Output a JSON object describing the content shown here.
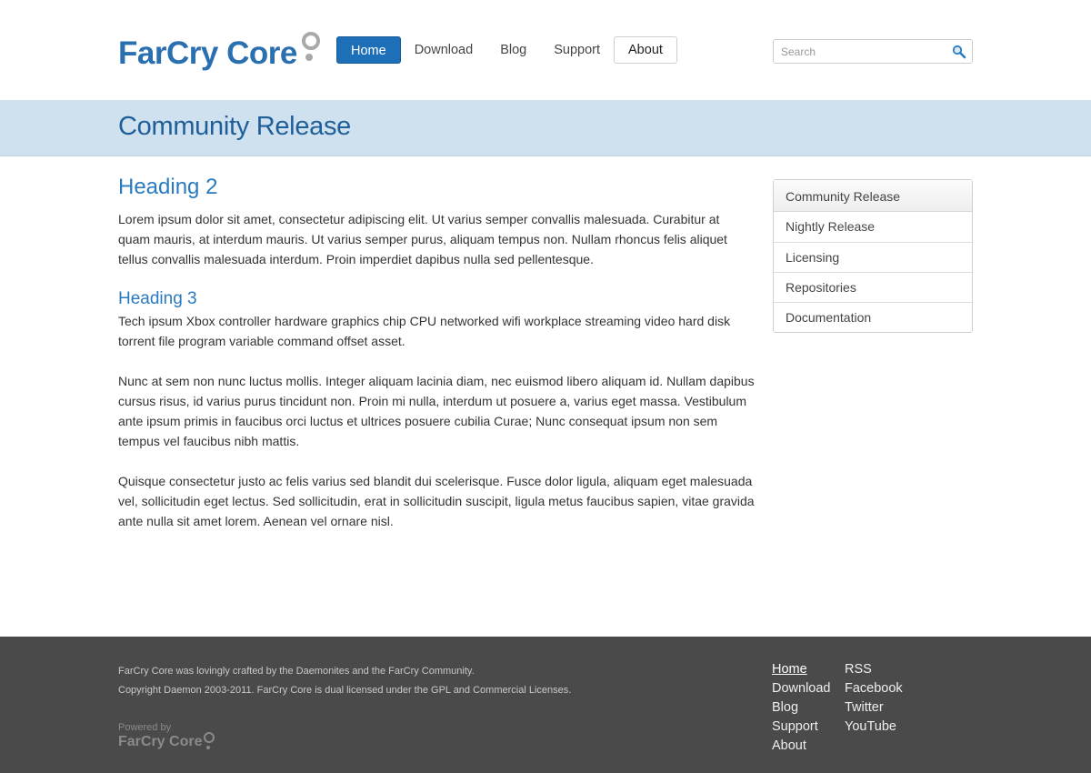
{
  "brand": {
    "logo_text_a": "FarCry",
    "logo_text_b": "Core"
  },
  "nav": {
    "items": [
      {
        "label": "Home",
        "state": "active"
      },
      {
        "label": "Download",
        "state": "normal"
      },
      {
        "label": "Blog",
        "state": "normal"
      },
      {
        "label": "Support",
        "state": "normal"
      },
      {
        "label": "About",
        "state": "outlined"
      }
    ]
  },
  "search": {
    "placeholder": "Search",
    "value": "",
    "icon": "magnifier-icon"
  },
  "banner": {
    "title": "Community Release"
  },
  "content": {
    "heading2": "Heading 2",
    "para1": "Lorem ipsum dolor sit amet, consectetur adipiscing elit. Ut varius semper convallis malesuada. Curabitur at quam mauris, at interdum mauris. Ut varius semper purus, aliquam tempus non. Nullam rhoncus felis aliquet tellus convallis malesuada interdum. Proin imperdiet dapibus nulla sed pellentesque.",
    "heading3": "Heading 3",
    "para2": "Tech ipsum Xbox controller hardware graphics chip CPU networked wifi workplace streaming video hard disk torrent file program variable command offset asset.",
    "para3": "Nunc at sem non nunc luctus mollis. Integer aliquam lacinia diam, nec euismod libero aliquam id. Nullam dapibus cursus risus, id varius purus tincidunt non. Proin mi nulla, interdum ut posuere a, varius eget massa. Vestibulum ante ipsum primis in faucibus orci luctus et ultrices posuere cubilia Curae; Nunc consequat ipsum non sem tempus vel faucibus nibh mattis.",
    "para4": "Quisque consectetur justo ac felis varius sed blandit dui scelerisque. Fusce dolor ligula, aliquam eget malesuada vel, sollicitudin eget lectus. Sed sollicitudin, erat in sollicitudin suscipit, ligula metus faucibus sapien, vitae gravida ante nulla sit amet lorem. Aenean vel ornare nisl."
  },
  "sidebar": {
    "items": [
      {
        "label": "Community Release"
      },
      {
        "label": "Nightly Release"
      },
      {
        "label": "Licensing"
      },
      {
        "label": "Repositories"
      },
      {
        "label": "Documentation"
      }
    ]
  },
  "footer": {
    "line1": "FarCry Core was lovingly crafted by the Daemonites and the FarCry Community.",
    "line2": "Copyright Daemon 2003-2011. FarCry Core is dual licensed under the GPL and Commercial Licenses.",
    "powered_label": "Powered by",
    "powered_logo": "FarCry Core",
    "links_col1": [
      "Home",
      "Download",
      "Blog",
      "Support",
      "About"
    ],
    "links_col2": [
      "RSS",
      "Facebook",
      "Twitter",
      "YouTube"
    ]
  },
  "colors": {
    "accent": "#1d6fb8",
    "heading": "#2a7ac0",
    "banner_bg": "#cfe0ef",
    "footer_bg": "#4a4a4a"
  }
}
